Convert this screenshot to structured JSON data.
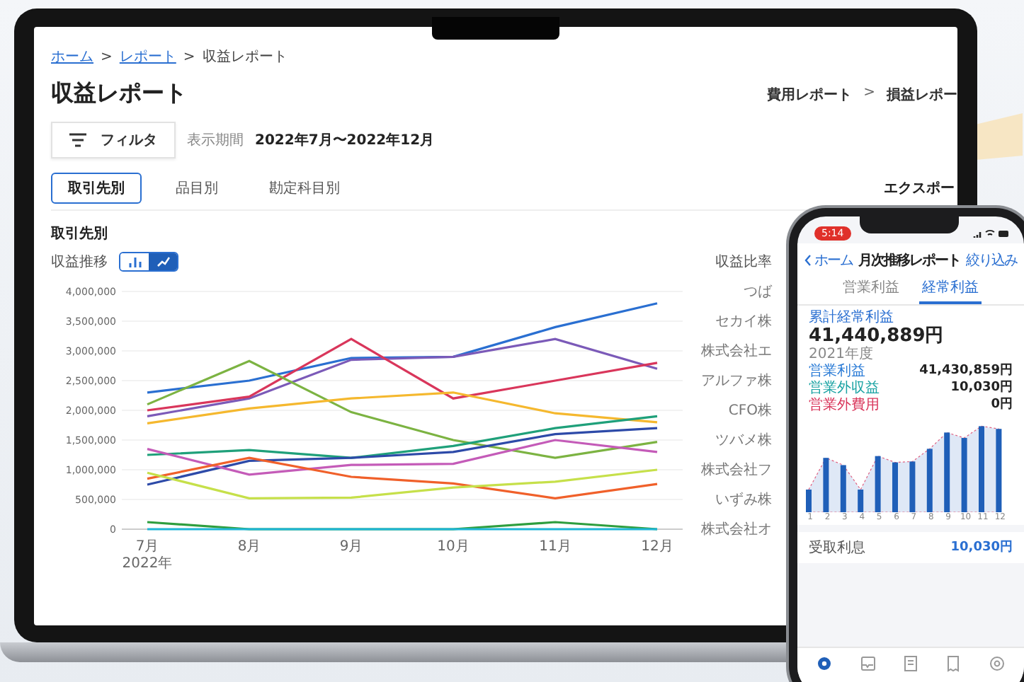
{
  "breadcrumb": [
    {
      "kind": "link",
      "text": "ホーム"
    },
    {
      "kind": "separator",
      "text": ">"
    },
    {
      "kind": "link",
      "text": "レポート"
    },
    {
      "kind": "separator",
      "text": ">"
    },
    {
      "kind": "current",
      "text": "収益レポート"
    }
  ],
  "page_title": "収益レポート",
  "related_reports": [
    {
      "kind": "link",
      "text": "費用レポート"
    },
    {
      "kind": "separator",
      "text": ">"
    },
    {
      "kind": "link",
      "text": "損益レポー"
    }
  ],
  "filter": {
    "button": "フィルタ",
    "period_label": "表示期間",
    "period": "2022年7月〜2022年12月"
  },
  "tabs": [
    {
      "label": "取引先別",
      "selected": true
    },
    {
      "label": "品目別",
      "selected": false
    },
    {
      "label": "勘定科目別",
      "selected": false
    }
  ],
  "export": "エクスポー",
  "section_title": "取引先別",
  "revenue_trend": {
    "title": "収益推移",
    "view_toggle": [
      {
        "kind": "bar",
        "selected": false
      },
      {
        "kind": "line",
        "selected": true
      }
    ],
    "year_label": "2022年",
    "chart_data": {
      "type": "line",
      "grid": true,
      "categories": [
        "7月",
        "8月",
        "9月",
        "10月",
        "11月",
        "12月"
      ],
      "ylim": [
        0,
        4000000
      ],
      "yticks": [
        {
          "value": 0,
          "label": "0"
        },
        {
          "value": 500000,
          "label": "500,000"
        },
        {
          "value": 1000000,
          "label": "1,000,000"
        },
        {
          "value": 1500000,
          "label": "1,500,000"
        },
        {
          "value": 2000000,
          "label": "2,000,000"
        },
        {
          "value": 2500000,
          "label": "2,500,000"
        },
        {
          "value": 3000000,
          "label": "3,000,000"
        },
        {
          "value": 3500000,
          "label": "3,500,000"
        },
        {
          "value": 4000000,
          "label": "4,000,000"
        }
      ],
      "series": [
        {
          "color": "#2a6fd1",
          "values": [
            2300000,
            2500000,
            2880000,
            2900000,
            3400000,
            3800000
          ]
        },
        {
          "color": "#7b5ab8",
          "values": [
            1900000,
            2200000,
            2850000,
            2900000,
            3200000,
            2700000
          ]
        },
        {
          "color": "#d9365b",
          "values": [
            2000000,
            2230000,
            3200000,
            2200000,
            2500000,
            2800000
          ]
        },
        {
          "color": "#7cb342",
          "values": [
            2100000,
            2830000,
            1970000,
            1500000,
            1200000,
            1470000
          ]
        },
        {
          "color": "#f5b82e",
          "values": [
            1780000,
            2030000,
            2200000,
            2300000,
            1950000,
            1800000
          ]
        },
        {
          "color": "#1fa07a",
          "values": [
            1250000,
            1330000,
            1200000,
            1400000,
            1700000,
            1900000
          ]
        },
        {
          "color": "#2d4aa8",
          "values": [
            750000,
            1150000,
            1200000,
            1300000,
            1600000,
            1700000
          ]
        },
        {
          "color": "#c45bb8",
          "values": [
            1350000,
            920000,
            1080000,
            1100000,
            1500000,
            1300000
          ]
        },
        {
          "color": "#f0602a",
          "values": [
            850000,
            1200000,
            880000,
            770000,
            520000,
            760000
          ]
        },
        {
          "color": "#c6e04a",
          "values": [
            950000,
            520000,
            530000,
            700000,
            800000,
            1000000
          ]
        },
        {
          "color": "#2e9e3e",
          "values": [
            120000,
            0,
            0,
            0,
            120000,
            0
          ]
        },
        {
          "color": "#1fb5d6",
          "values": [
            0,
            0,
            0,
            0,
            0,
            0
          ]
        }
      ]
    }
  },
  "revenue_share": {
    "title": "収益比率",
    "labels": [
      "つば",
      "セカイ株",
      "株式会社エ",
      "アルファ株",
      "CFO株",
      "ツバメ株",
      "株式会社フ",
      "いずみ株",
      "株式会社オ"
    ]
  },
  "phone": {
    "time": "5:14",
    "back": "ホーム",
    "title": "月次推移レポート",
    "action": "絞り込み",
    "tabs": [
      {
        "label": "営業利益",
        "selected": false
      },
      {
        "label": "経常利益",
        "selected": true
      }
    ],
    "summary": {
      "label": "累計経常利益",
      "value": "41,440,889円",
      "year": "2021年度",
      "breakdown": [
        {
          "label": "営業利益",
          "value": "41,430,859円",
          "color": "#2a7bd6"
        },
        {
          "label": "営業外収益",
          "value": "10,030円",
          "color": "#1aa3a3"
        },
        {
          "label": "営業外費用",
          "value": "0円",
          "color": "#d9365b"
        }
      ]
    },
    "months": [
      "1",
      "2",
      "3",
      "4",
      "5",
      "6",
      "7",
      "8",
      "9",
      "10",
      "11",
      "12"
    ],
    "list_item": {
      "label": "受取利息",
      "value": "10,030円"
    },
    "nav": [
      {
        "kind": "home",
        "selected": true
      },
      {
        "kind": "deals",
        "selected": false
      },
      {
        "kind": "invoice",
        "selected": false
      },
      {
        "kind": "expense",
        "selected": false
      },
      {
        "kind": "settings",
        "selected": false
      }
    ]
  }
}
